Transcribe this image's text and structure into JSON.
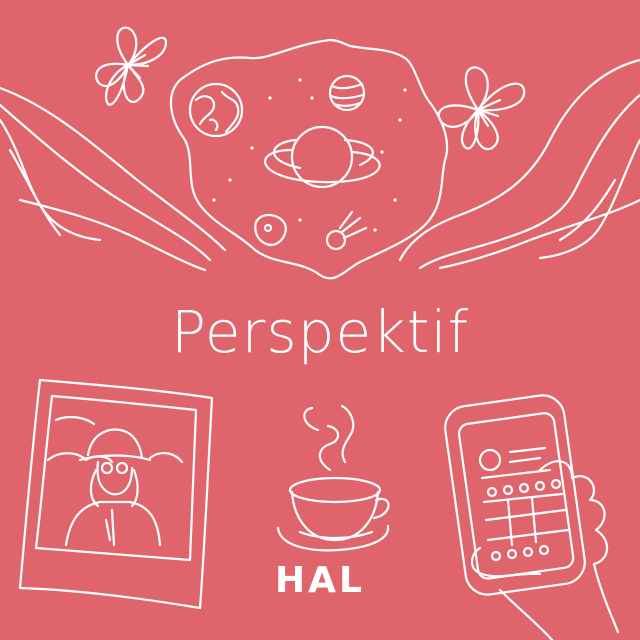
{
  "cover": {
    "title": "Perspektif",
    "brand": "HAL",
    "background_color": "#e0646b",
    "line_color": "#ffffff"
  },
  "illustrations": [
    "lily-flower-icon",
    "planet-icon",
    "ringed-planet-icon",
    "comet-icon",
    "asteroid-icon",
    "polaroid-photo-icon",
    "coffee-cup-icon",
    "smartphone-in-hand-icon"
  ]
}
